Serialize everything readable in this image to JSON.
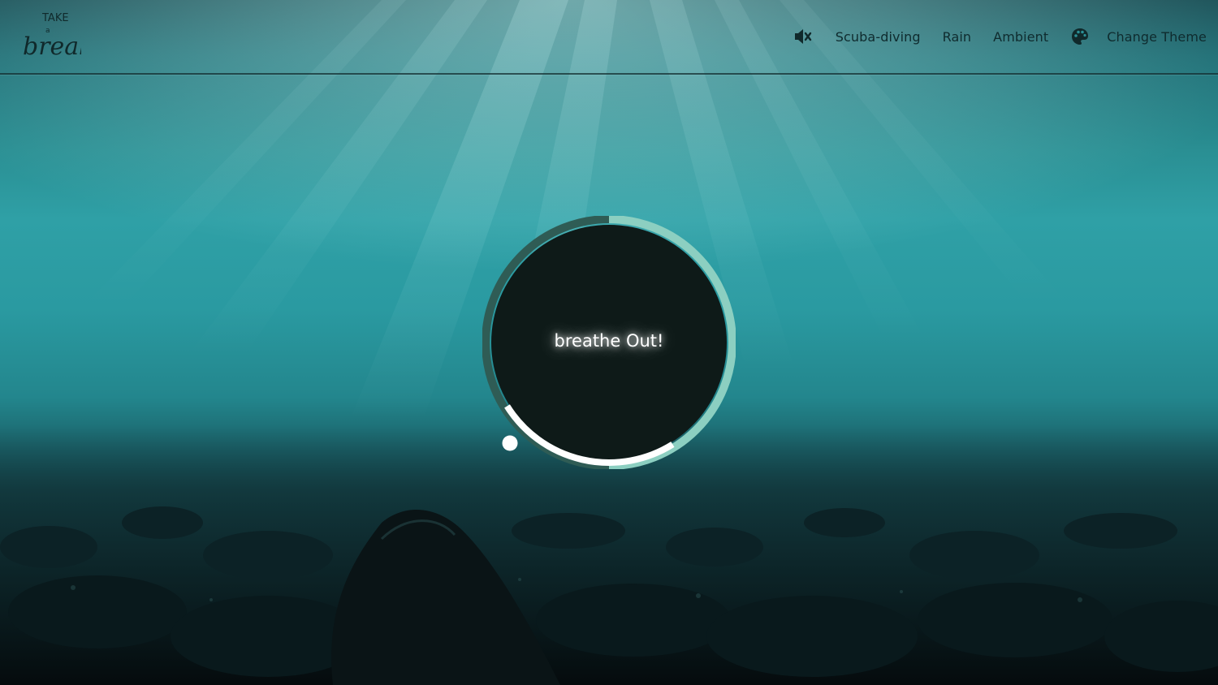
{
  "header": {
    "logo_text": [
      "TAKE",
      "a",
      "break"
    ],
    "nav": {
      "mute_icon": "volume-mute-icon",
      "links": [
        {
          "label": "Scuba-diving"
        },
        {
          "label": "Rain"
        },
        {
          "label": "Ambient"
        }
      ],
      "theme_icon": "palette-icon",
      "change_theme_label": "Change Theme"
    }
  },
  "breathing": {
    "instruction": "breathe Out!",
    "progress_fraction": 0.25
  },
  "colors": {
    "ring_light": "#8ccfc1",
    "ring_dark": "#2f5c55",
    "ring_progress": "#ffffff",
    "circle_fill": "#0e1a18",
    "nav_text": "#0f2b2e"
  }
}
